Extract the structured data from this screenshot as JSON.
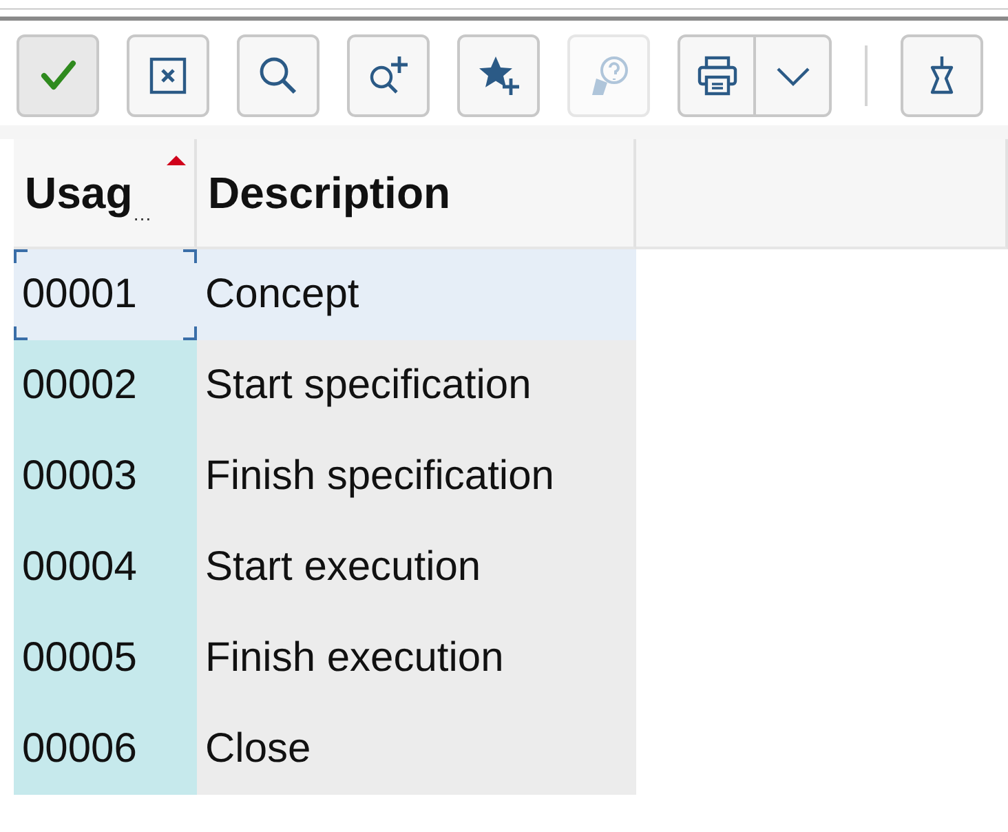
{
  "toolbar": {
    "buttons": [
      {
        "kind": "check",
        "disabled": false,
        "pressed": true
      },
      {
        "kind": "cancel",
        "disabled": false,
        "pressed": false
      },
      {
        "kind": "search",
        "disabled": false,
        "pressed": false
      },
      {
        "kind": "search-more",
        "disabled": false,
        "pressed": false
      },
      {
        "kind": "favorite-add",
        "disabled": false,
        "pressed": false
      },
      {
        "kind": "help",
        "disabled": true,
        "pressed": false
      },
      {
        "kind": "print-menu",
        "disabled": false,
        "pressed": false
      },
      {
        "kind": "separator"
      },
      {
        "kind": "pin",
        "disabled": false,
        "pressed": false
      }
    ]
  },
  "table": {
    "columns": [
      {
        "title": "Usag",
        "overflow_mark": "…",
        "sorted_ascending": true
      },
      {
        "title": "Description"
      }
    ],
    "rows": [
      {
        "cells": [
          "00001",
          "Concept"
        ],
        "selected": true,
        "focused": true
      },
      {
        "cells": [
          "00002",
          "Start specification"
        ],
        "selected": false,
        "focused": false
      },
      {
        "cells": [
          "00003",
          "Finish specification"
        ],
        "selected": false,
        "focused": false
      },
      {
        "cells": [
          "00004",
          "Start execution"
        ],
        "selected": false,
        "focused": false
      },
      {
        "cells": [
          "00005",
          "Finish execution"
        ],
        "selected": false,
        "focused": false
      },
      {
        "cells": [
          "00006",
          "Close"
        ],
        "selected": false,
        "focused": false
      }
    ]
  }
}
